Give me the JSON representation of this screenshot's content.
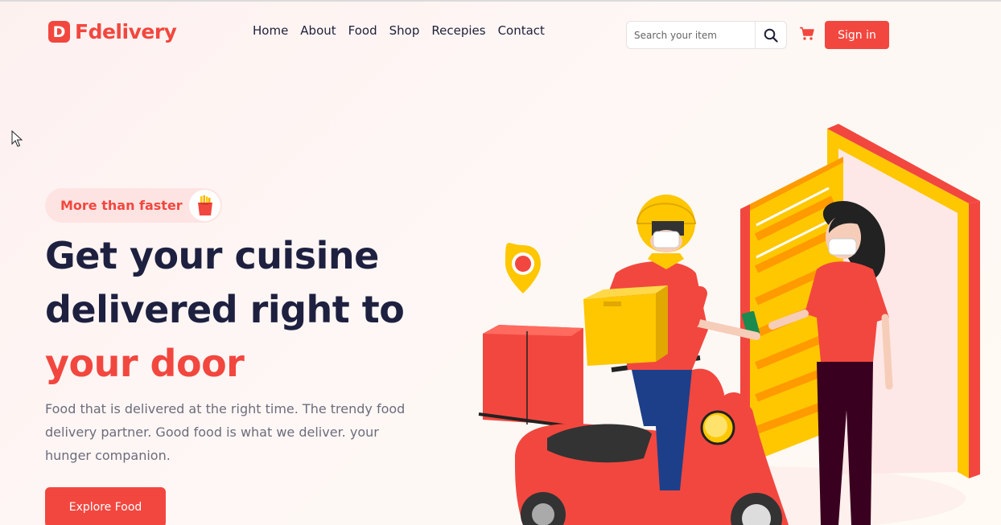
{
  "brand": {
    "mark": "D",
    "name": "Fdelivery",
    "color": "#f2473f"
  },
  "nav": {
    "items": [
      "Home",
      "About",
      "Food",
      "Shop",
      "Recepies",
      "Contact"
    ]
  },
  "search": {
    "placeholder": "Search your item",
    "icon": "search-icon"
  },
  "cart": {
    "icon": "cart-icon"
  },
  "signin": {
    "label": "Sign in"
  },
  "hero": {
    "badge": {
      "label": "More than faster",
      "icon": "fries-icon"
    },
    "headline": {
      "line1": "Get your cuisine",
      "line2": "delivered right to",
      "line3": "your door"
    },
    "description": "Food that is delivered at the right time. The trendy food delivery partner. Good food is what we deliver. your hunger companion.",
    "cta": "Explore Food"
  },
  "colors": {
    "accent": "#f2473f",
    "heading": "#1e2040",
    "yellow": "#ffc700"
  }
}
